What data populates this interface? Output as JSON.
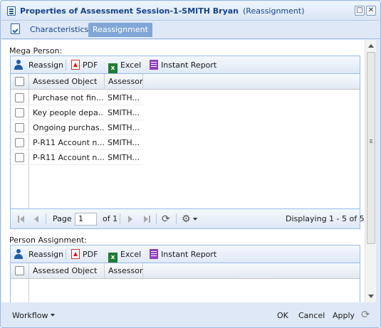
{
  "window": {
    "title": "Properties of Assessment Session-1-SMITH Bryan",
    "subtitle": "(Reassignment)",
    "maximize_glyph": "□",
    "close_glyph": "✕"
  },
  "tabs": [
    {
      "label": "Characteristics",
      "active": false
    },
    {
      "label": "Reassignment",
      "active": true
    }
  ],
  "mega_person": {
    "label": "Mega Person:",
    "toolbar": {
      "reassign": "Reassign",
      "pdf": "PDF",
      "excel": "Excel",
      "excel_icon_letter": "x",
      "instant_report": "Instant Report"
    },
    "columns": [
      "Assessed Object",
      "Assessor"
    ],
    "rows": [
      {
        "object": "Purchase not fin...",
        "assessor": "SMITH..."
      },
      {
        "object": "Key people depa...",
        "assessor": "SMITH..."
      },
      {
        "object": "Ongoing purchas...",
        "assessor": "SMITH..."
      },
      {
        "object": "P-R11 Account n...",
        "assessor": "SMITH..."
      },
      {
        "object": "P-R11 Account n...",
        "assessor": "SMITH..."
      }
    ],
    "pager": {
      "page_label": "Page",
      "page_value": "1",
      "of_label": "of 1",
      "refresh_glyph": "⟳",
      "gear_glyph": "⚙",
      "displaying": "Displaying 1 - 5 of 5"
    }
  },
  "person_assignment": {
    "label": "Person Assignment:",
    "toolbar": {
      "reassign": "Reassign",
      "pdf": "PDF",
      "excel": "Excel",
      "excel_icon_letter": "x",
      "instant_report": "Instant Report"
    },
    "columns": [
      "Assessed Object",
      "Assessor"
    ]
  },
  "footer": {
    "workflow": "Workflow",
    "ok": "OK",
    "cancel": "Cancel",
    "apply": "Apply",
    "refresh_glyph": "⟳"
  },
  "colors": {
    "title_text": "#15428b",
    "active_tab": "#7fa6d6",
    "border": "#99bbe8"
  }
}
